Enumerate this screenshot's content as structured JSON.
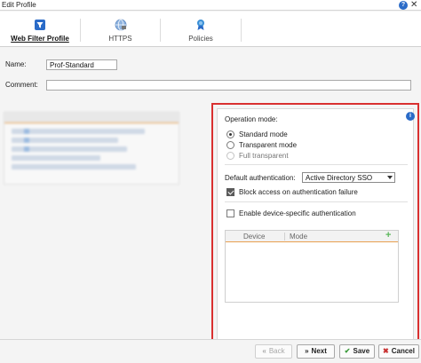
{
  "window": {
    "title": "Edit Profile",
    "help_glyph": "?",
    "close_glyph": "✕"
  },
  "tabs": [
    {
      "label": "Web Filter Profile",
      "icon": "filter-icon",
      "active": true
    },
    {
      "label": "HTTPS",
      "icon": "globe-icon",
      "active": false
    },
    {
      "label": "Policies",
      "icon": "ribbon-icon",
      "active": false
    }
  ],
  "form": {
    "name_label": "Name:",
    "name_value": "Prof-Standard",
    "comment_label": "Comment:",
    "comment_value": ""
  },
  "panel": {
    "operation_mode_label": "Operation mode:",
    "info_glyph": "i",
    "modes": [
      {
        "label": "Standard mode",
        "selected": true,
        "enabled": true
      },
      {
        "label": "Transparent mode",
        "selected": false,
        "enabled": true
      },
      {
        "label": "Full transparent",
        "selected": false,
        "enabled": false
      }
    ],
    "default_auth_label": "Default authentication:",
    "default_auth_value": "Active Directory SSO",
    "block_access_label": "Block access on authentication failure",
    "block_access_checked": true,
    "device_auth_label": "Enable device-specific authentication",
    "device_auth_checked": false,
    "table": {
      "columns": [
        "Device",
        "Mode"
      ],
      "add_glyph": "+",
      "rows": []
    }
  },
  "footer": {
    "back_label": "Back",
    "back_glyph": "«",
    "next_label": "Next",
    "next_glyph": "»",
    "save_label": "Save",
    "save_glyph": "✔",
    "cancel_label": "Cancel",
    "cancel_glyph": "✖"
  },
  "colors": {
    "accent": "#2a6bc8",
    "highlight_border": "#d93030",
    "add": "#5cb85c",
    "save_check": "#3a9a3a",
    "cancel_x": "#c83030"
  }
}
